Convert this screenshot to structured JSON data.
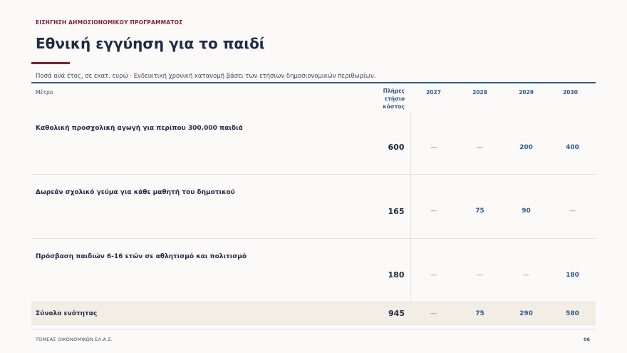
{
  "kicker": "ΕΙΣΗΓΗΣΗ ΔΗΜΟΣΙΟΝΟΜΙΚΟΥ ΠΡΟΓΡΑΜΜΑΤΟΣ",
  "title": "Εθνική εγγύηση για το παιδί",
  "subtitle": "Ποσά ανά έτος, σε εκατ. ευρώ · Ενδεικτική χρονική κατανομή βάσει των ετήσιων δημοσιονομικών περιθωρίων.",
  "table": {
    "headers": {
      "measure": "Μέτρο",
      "cost": "Πλήρες ετήσιο κόστος",
      "years": [
        "2027",
        "2028",
        "2029",
        "2030"
      ]
    },
    "rows": [
      {
        "measure": "Καθολική προσχολική αγωγή για περίπου 300.000 παιδιά",
        "cost": "600",
        "years": [
          "—",
          "—",
          "200",
          "400"
        ]
      },
      {
        "measure": "Δωρεάν σχολικό γεύμα για κάθε μαθητή του δημοτικού",
        "cost": "165",
        "years": [
          "—",
          "75",
          "90",
          "—"
        ]
      },
      {
        "measure": "Πρόσβαση παιδιών 6-16 ετών σε αθλητισμό και πολιτισμό",
        "cost": "180",
        "years": [
          "—",
          "—",
          "—",
          "180"
        ]
      }
    ],
    "total": {
      "measure": "Σύνολο ενότητας",
      "cost": "945",
      "years": [
        "—",
        "75",
        "290",
        "580"
      ]
    }
  },
  "footer": {
    "left": "ΤΟΜΕΑΣ ΟΙΚΟΝΟΜΙΚΩΝ ΕΛ.Α.Σ.",
    "page": "06"
  }
}
